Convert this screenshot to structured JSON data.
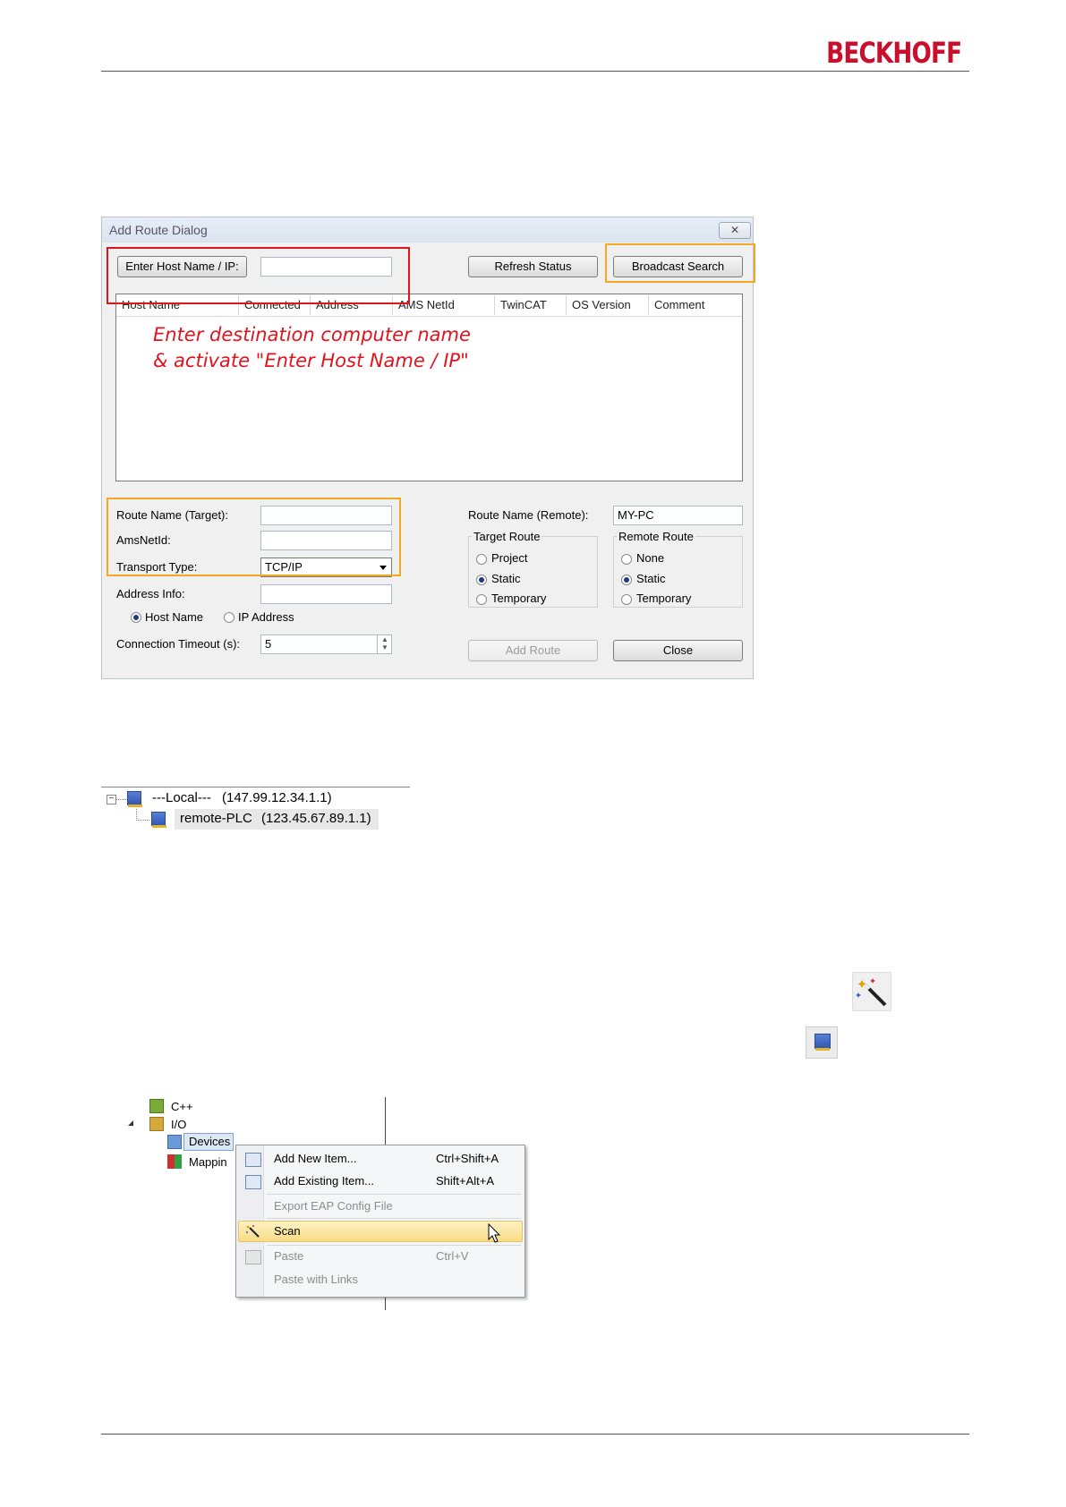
{
  "header": {
    "logo": "BECKHOFF"
  },
  "dialog": {
    "title": "Add Route Dialog",
    "close_glyph": "✕",
    "enter_host_button": "Enter Host Name / IP:",
    "host_input_value": "",
    "refresh_button": "Refresh Status",
    "broadcast_button": "Broadcast Search",
    "columns": [
      "Host Name",
      "Connected",
      "Address",
      "AMS NetId",
      "TwinCAT",
      "OS Version",
      "Comment"
    ],
    "annotation_line1": "Enter destination computer name",
    "annotation_line2": "& activate \"Enter Host Name / IP\"",
    "route_name_target_label": "Route Name (Target):",
    "route_name_target_value": "",
    "amsnetid_label": "AmsNetId:",
    "amsnetid_value": "",
    "transport_type_label": "Transport Type:",
    "transport_type_value": "TCP/IP",
    "address_info_label": "Address Info:",
    "address_info_value": "",
    "addr_host_name": "Host Name",
    "addr_ip_address": "IP Address",
    "timeout_label": "Connection Timeout (s):",
    "timeout_value": "5",
    "route_name_remote_label": "Route Name (Remote):",
    "route_name_remote_value": "MY-PC",
    "target_route": {
      "title": "Target Route",
      "options": [
        "Project",
        "Static",
        "Temporary"
      ],
      "selected": "Static"
    },
    "remote_route": {
      "title": "Remote Route",
      "options": [
        "None",
        "Static",
        "Temporary"
      ],
      "selected": "Static"
    },
    "add_route_button": "Add Route",
    "close_button": "Close"
  },
  "route_tree": {
    "local_label": "---Local---",
    "local_address": "(147.99.12.34.1.1)",
    "remote_label": "remote-PLC",
    "remote_address": "(123.45.67.89.1.1)"
  },
  "solution_tree": {
    "cpp": "C++",
    "io": "I/O",
    "devices": "Devices",
    "mappings": "Mappin"
  },
  "context_menu": {
    "items": [
      {
        "label": "Add New Item...",
        "shortcut": "Ctrl+Shift+A"
      },
      {
        "label": "Add Existing Item...",
        "shortcut": "Shift+Alt+A"
      },
      {
        "label": "Export EAP Config File",
        "shortcut": ""
      },
      {
        "label": "Scan",
        "shortcut": ""
      },
      {
        "label": "Paste",
        "shortcut": "Ctrl+V"
      },
      {
        "label": "Paste with Links",
        "shortcut": ""
      }
    ]
  },
  "colors": {
    "brand": "#c8102e",
    "annotation_red": "#e0141e",
    "highlight_orange": "#f5a623"
  }
}
